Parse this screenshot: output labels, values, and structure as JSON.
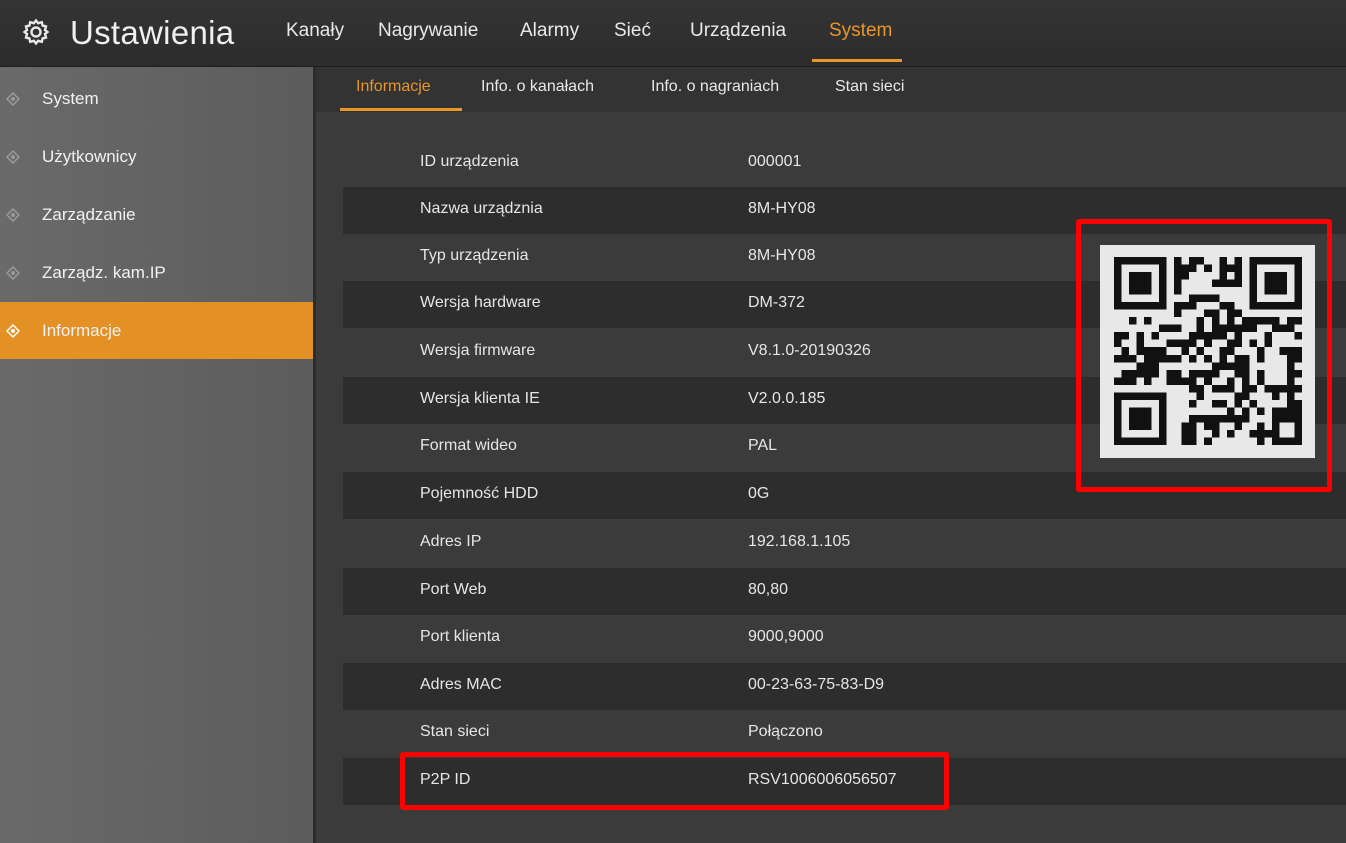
{
  "header": {
    "title": "Ustawienia",
    "tabs": [
      {
        "label": "Kanały"
      },
      {
        "label": "Nagrywanie"
      },
      {
        "label": "Alarmy"
      },
      {
        "label": "Sieć"
      },
      {
        "label": "Urządzenia"
      },
      {
        "label": "System"
      }
    ],
    "active_tab": "System"
  },
  "sidebar": {
    "items": [
      {
        "label": "System"
      },
      {
        "label": "Użytkownicy"
      },
      {
        "label": "Zarządzanie"
      },
      {
        "label": "Zarządz. kam.IP"
      },
      {
        "label": "Informacje"
      }
    ],
    "active_item": "Informacje"
  },
  "subtabs": {
    "items": [
      {
        "label": "Informacje"
      },
      {
        "label": "Info. o kanałach"
      },
      {
        "label": "Info. o nagraniach"
      },
      {
        "label": "Stan sieci"
      }
    ],
    "active": "Informacje"
  },
  "info_rows": [
    {
      "label": "ID urządzenia",
      "value": "000001"
    },
    {
      "label": "Nazwa urządznia",
      "value": "8M-HY08"
    },
    {
      "label": "Typ urządzenia",
      "value": "8M-HY08"
    },
    {
      "label": "Wersja hardware",
      "value": "DM-372"
    },
    {
      "label": "Wersja firmware",
      "value": "V8.1.0-20190326"
    },
    {
      "label": "Wersja klienta IE",
      "value": "V2.0.0.185"
    },
    {
      "label": "Format wideo",
      "value": "PAL"
    },
    {
      "label": "Pojemność HDD",
      "value": "0G"
    },
    {
      "label": "Adres IP",
      "value": "192.168.1.105"
    },
    {
      "label": "Port Web",
      "value": "80,80"
    },
    {
      "label": "Port klienta",
      "value": "9000,9000"
    },
    {
      "label": "Adres MAC",
      "value": "00-23-63-75-83-D9"
    },
    {
      "label": "Stan sieci",
      "value": "Połączono"
    },
    {
      "label": "P2P ID",
      "value": "RSV1006006056507"
    }
  ],
  "icons": {
    "settings": "gear-icon",
    "sidebar_bullet": "diamond-bullet-icon",
    "qr": "qr-code-icon"
  },
  "colors": {
    "accent": "#e8952a",
    "highlight": "#ff0000",
    "sidebar_active": "#e39125"
  }
}
